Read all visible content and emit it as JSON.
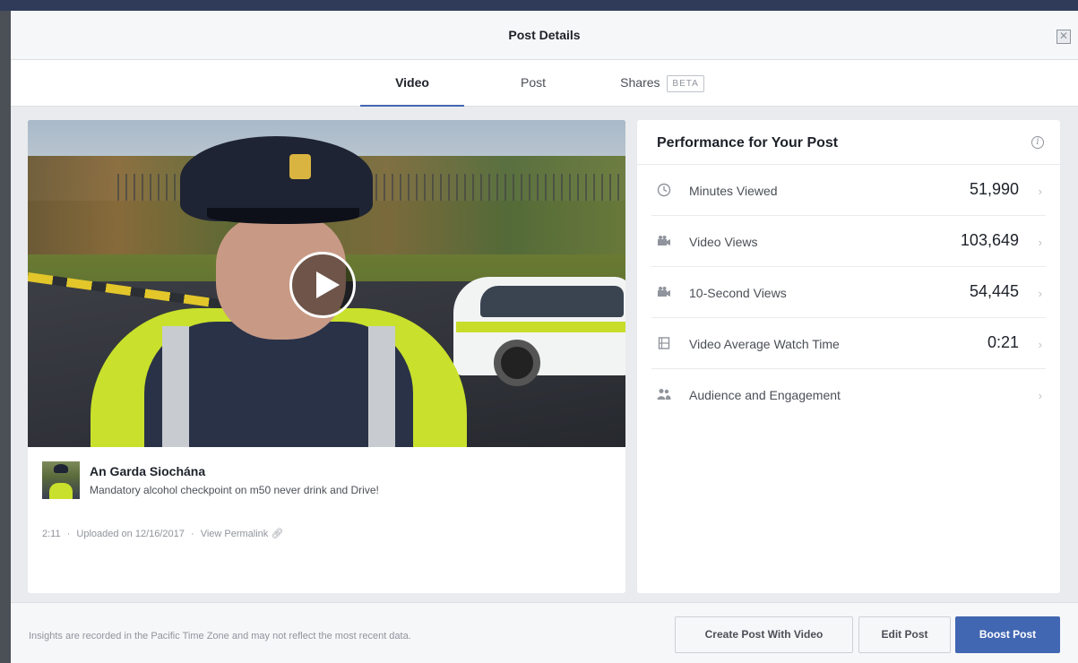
{
  "modal": {
    "title": "Post Details",
    "close_icon": "close-icon"
  },
  "tabs": [
    {
      "label": "Video",
      "active": true
    },
    {
      "label": "Post",
      "active": false
    },
    {
      "label": "Shares",
      "badge": "BETA",
      "active": false
    }
  ],
  "video": {
    "play_icon": "play-icon",
    "page_name": "An Garda Siochána",
    "post_text": "Mandatory alcohol checkpoint on m50 never drink and Drive!",
    "duration": "2:11",
    "uploaded": "Uploaded on 12/16/2017",
    "permalink_label": "View Permalink",
    "link_icon": "link-icon"
  },
  "performance": {
    "title": "Performance for Your Post",
    "info_icon": "info-icon",
    "metrics": [
      {
        "icon": "clock-icon",
        "label": "Minutes Viewed",
        "value": "51,990"
      },
      {
        "icon": "camera-icon",
        "label": "Video Views",
        "value": "103,649"
      },
      {
        "icon": "camera-icon",
        "label": "10-Second Views",
        "value": "54,445"
      },
      {
        "icon": "film-icon",
        "label": "Video Average Watch Time",
        "value": "0:21"
      },
      {
        "icon": "people-icon",
        "label": "Audience and Engagement",
        "value": ""
      }
    ]
  },
  "footer": {
    "note": "Insights are recorded in the Pacific Time Zone and may not reflect the most recent data.",
    "create_label": "Create Post With Video",
    "edit_label": "Edit Post",
    "boost_label": "Boost Post"
  },
  "colors": {
    "accent": "#4267b2",
    "header_bg": "#f6f7f9",
    "body_bg": "#e9ebee"
  }
}
